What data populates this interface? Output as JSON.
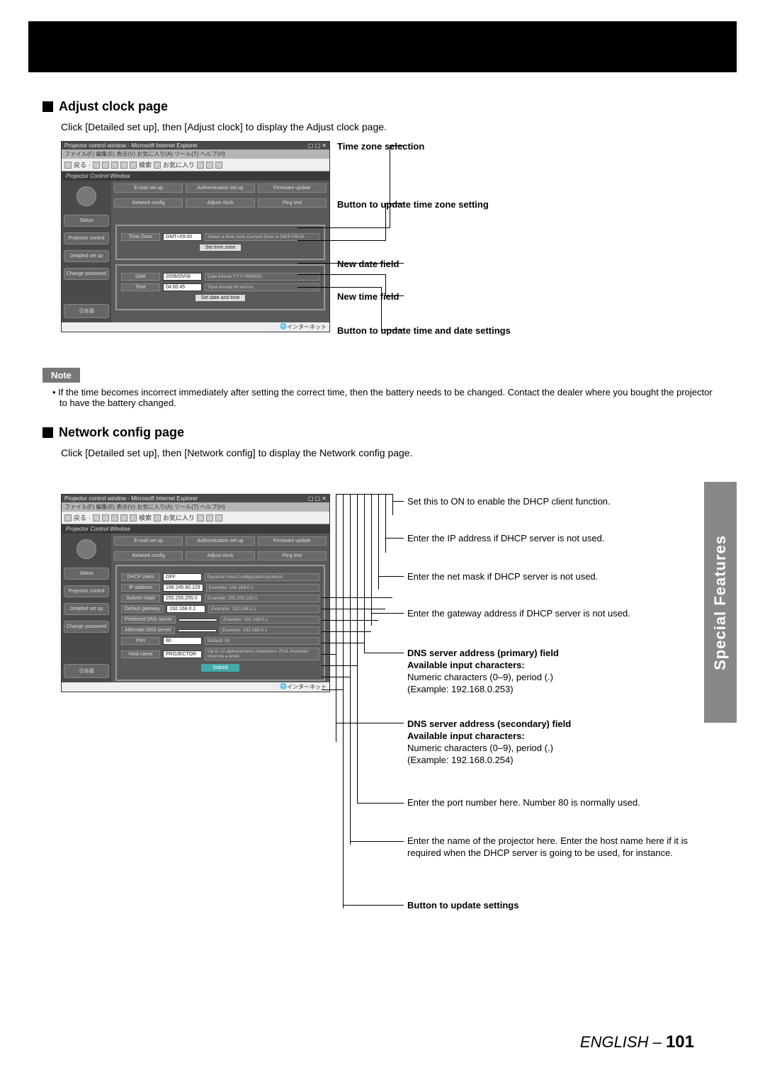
{
  "section1": {
    "heading": "Adjust clock page",
    "intro": "Click [Detailed set up], then [Adjust clock] to display the Adjust clock page.",
    "callouts": {
      "timezone": "Time zone selection",
      "tz_button": "Button to update time zone setting",
      "date_field": "New date field",
      "time_field": "New time field",
      "dt_button": "Button to update time and date settings"
    },
    "note_label": "Note",
    "note_text": "If the time becomes incorrect immediately after setting the correct time, then the battery needs to be changed. Contact the dealer where you bought the projector to have the battery changed."
  },
  "section2": {
    "heading": "Network config page",
    "intro": "Click [Detailed set up], then [Network config] to display the Network config page.",
    "callouts": {
      "dhcp": "Set this to ON to enable the DHCP client function.",
      "ip": "Enter the IP address if DHCP server is not used.",
      "mask": "Enter the net mask if DHCP server is not used.",
      "gateway": "Enter the gateway address if DHCP server is not used.",
      "dns1_head": "DNS server address (primary) field",
      "avail_head": "Available input characters:",
      "dns1_chars": "Numeric characters (0–9), period (.)",
      "dns1_ex": "(Example: 192.168.0.253)",
      "dns2_head": "DNS server address (secondary) field",
      "dns2_chars": "Numeric characters (0–9), period (.)",
      "dns2_ex": "(Example: 192.168.0.254)",
      "port": "Enter the port number here. Number 80 is normally used.",
      "host": "Enter the name of the projector here. Enter the host name here if it is required when the DHCP server is going to be used, for instance.",
      "submit": "Button to update settings"
    }
  },
  "screenshot": {
    "title": "Projector control window - Microsoft Internet Explorer",
    "menubar": "ファイル(F)  編集(E)  表示(V)  お気に入り(A)  ツール(T)  ヘルプ(H)",
    "toolbar_back": "戻る",
    "toolbar_search": "検索",
    "toolbar_fav": "お気に入り",
    "proj_title": "Projector Control Window",
    "sidebar": {
      "status": "Status",
      "projector_control": "Projector control",
      "detailed_setup": "Detailed set up",
      "change_password": "Change password",
      "japanese": "日本語"
    },
    "tabs": {
      "email": "E-mail set up",
      "auth": "Authentication set up",
      "firmware": "Firmware update",
      "network": "Network config",
      "clock": "Adjust clock",
      "ping": "Ping test"
    },
    "clock_form": {
      "timezone_label": "Time Zone",
      "timezone_value": "GMT+09:00",
      "timezone_hint": "Select a time zone Current Zone is GMT+09:00",
      "set_tz_btn": "Set time zone",
      "date_label": "Date",
      "date_value": "2008/05/08",
      "date_hint": "Date format YYYY/MM/DD",
      "time_label": "Time",
      "time_value": "04:00:45",
      "time_hint": "Time format hh:mm:ss",
      "set_dt_btn": "Set date and time"
    },
    "net_form": {
      "dhcp_label": "DHCP client",
      "dhcp_value": "OFF",
      "dhcp_hint": "Dynamic Host Configuration protocol",
      "ip_label": "IP address",
      "ip_value": "198.245.80.129",
      "ip_hint": "Example: 192.168.0.1",
      "mask_label": "Subnet mask",
      "mask_value": "255.255.255.0",
      "mask_hint": "Example: 255.255.255.0",
      "gw_label": "Default gateway",
      "gw_value": "192.168.0.1",
      "gw_hint": "Example: 192.168.0.1",
      "dns1_label": "Preferred DNS server",
      "dns1_value": "",
      "dns1_hint": "Example: 192.168.0.1",
      "dns2_label": "Alternate DNS server",
      "dns2_value": "",
      "dns2_hint": "Example: 192.168.0.1",
      "port_label": "Port",
      "port_value": "80",
      "port_hint": "Default: 80",
      "host_label": "Host name",
      "host_value": "PROJECTOR",
      "host_hint": "Up to 12 alphanumeric characters. First character must be a letter.",
      "submit": "Submit"
    },
    "statusbar": "インターネット"
  },
  "side_tab": "Special Features",
  "footer_lang": "ENGLISH",
  "footer_sep": " – ",
  "footer_page": "101"
}
